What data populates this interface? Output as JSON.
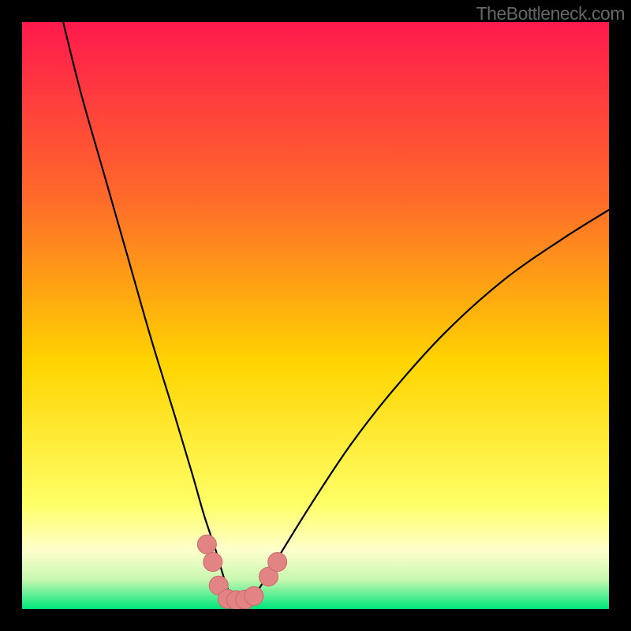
{
  "watermark": "TheBottleneck.com",
  "colors": {
    "frame": "#000000",
    "gradient_top": "#ff1a4d",
    "gradient_upper_mid": "#ff6a2a",
    "gradient_mid": "#ffd400",
    "gradient_lower_mid": "#ffff99",
    "gradient_near_bottom": "#b8f7a8",
    "gradient_bottom": "#00e67a",
    "curve": "#000000",
    "marker_fill": "#e38484",
    "marker_stroke": "#c96b6b",
    "watermark": "#666666"
  },
  "chart_data": {
    "type": "line",
    "title": "",
    "xlabel": "",
    "ylabel": "",
    "xlim": [
      0,
      100
    ],
    "ylim": [
      0,
      100
    ],
    "grid": false,
    "legend": false,
    "description": "Single V-shaped bottleneck curve. y is percent bottleneck (0 at bottom = no bottleneck / green, 100 at top = severe / red). x is an implicit hardware-balance axis. Minimum (optimal balance) occurs near x≈36.",
    "series": [
      {
        "name": "bottleneck-curve",
        "x": [
          7,
          10,
          14,
          18,
          22,
          26,
          29,
          31,
          33,
          34.5,
          36,
          38,
          40,
          42,
          45,
          50,
          56,
          63,
          72,
          82,
          92,
          100
        ],
        "y": [
          100,
          88,
          74,
          60,
          46,
          33,
          23,
          16,
          10,
          5,
          1.5,
          1.5,
          3,
          6,
          11,
          19,
          28,
          37,
          47,
          56,
          63,
          68
        ]
      }
    ],
    "markers": {
      "name": "highlight-points",
      "note": "Salmon/pink dots clustered around the curve minimum",
      "points": [
        {
          "x": 31.5,
          "y": 11
        },
        {
          "x": 32.5,
          "y": 8
        },
        {
          "x": 33.5,
          "y": 4
        },
        {
          "x": 35,
          "y": 1.7
        },
        {
          "x": 36.5,
          "y": 1.5
        },
        {
          "x": 38,
          "y": 1.6
        },
        {
          "x": 39.5,
          "y": 2.2
        },
        {
          "x": 42,
          "y": 5.5
        },
        {
          "x": 43.5,
          "y": 8
        }
      ]
    },
    "background_gradient": {
      "axis": "y",
      "stops": [
        {
          "y": 100,
          "color": "#ff1a4d"
        },
        {
          "y": 70,
          "color": "#ff6a2a"
        },
        {
          "y": 42,
          "color": "#ffd400"
        },
        {
          "y": 18,
          "color": "#ffff66"
        },
        {
          "y": 10,
          "color": "#ffffcc"
        },
        {
          "y": 5,
          "color": "#c8f7b0"
        },
        {
          "y": 0,
          "color": "#00e67a"
        }
      ]
    }
  }
}
